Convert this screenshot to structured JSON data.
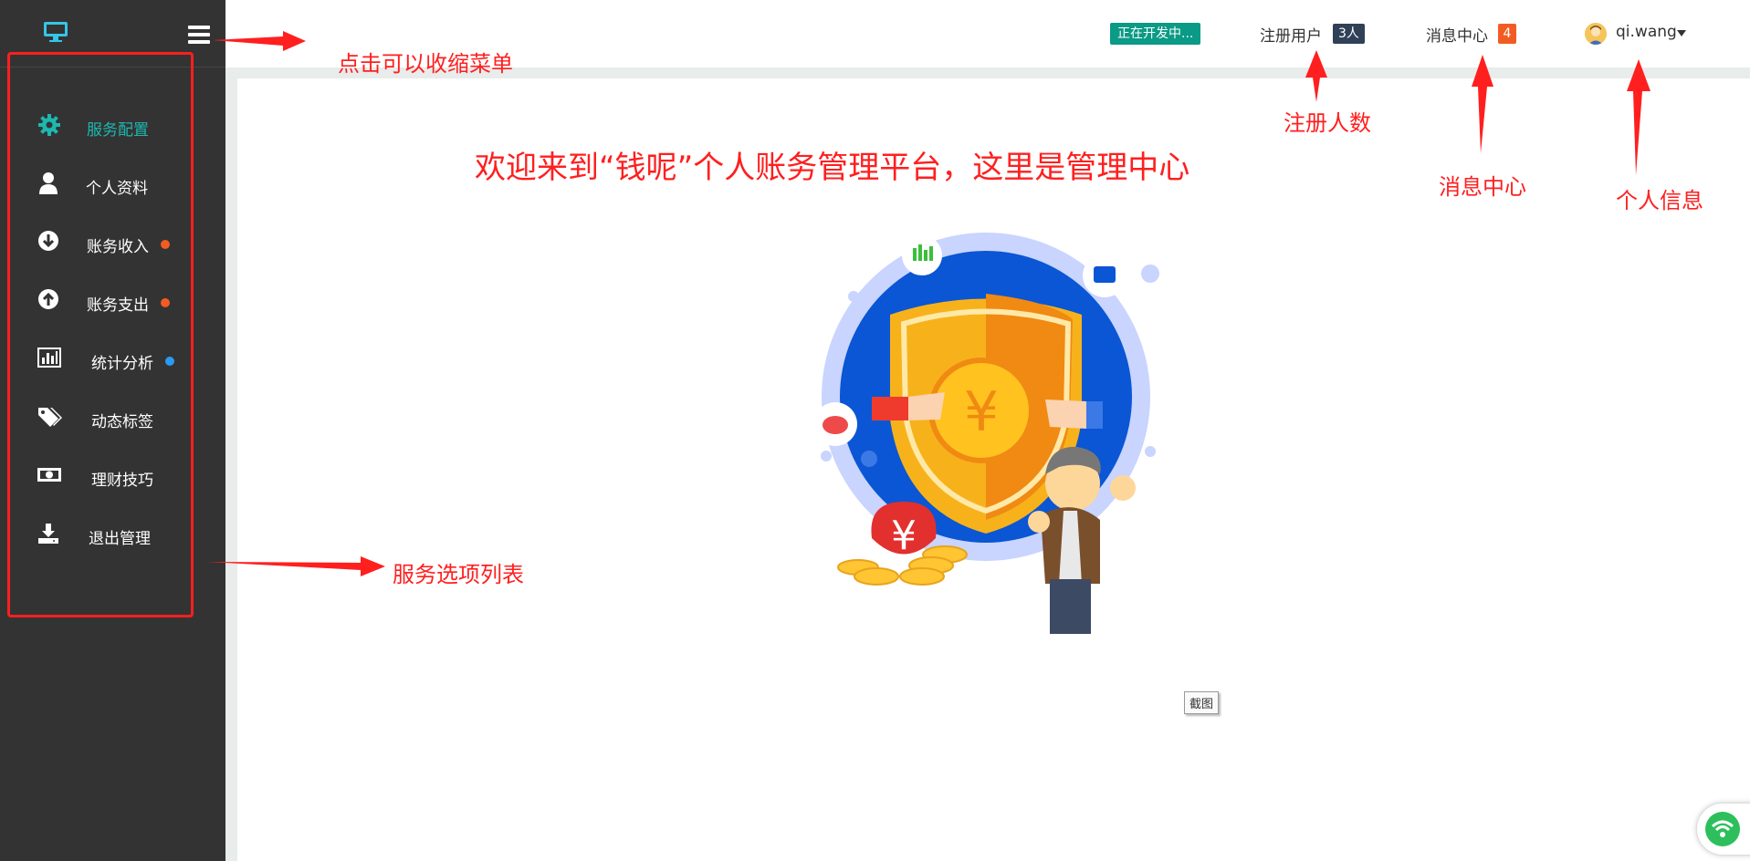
{
  "colors": {
    "sidebar_bg": "#333333",
    "active_teal": "#1cb8b0",
    "annotation_red": "#ff1f1f",
    "dev_badge": "#0b9a86",
    "reg_badge": "#2f4057",
    "msg_badge": "#f25c23",
    "dot_orange": "#f25c23",
    "dot_blue": "#2b9af3"
  },
  "sidebar": {
    "logo_icon": "monitor-icon",
    "toggle_icon": "hamburger-icon",
    "items": [
      {
        "label": "服务配置",
        "icon": "gear-icon",
        "active": true
      },
      {
        "label": "个人资料",
        "icon": "user-icon"
      },
      {
        "label": "账务收入",
        "icon": "arrow-circle-down-icon",
        "dot": "orange"
      },
      {
        "label": "账务支出",
        "icon": "arrow-circle-up-icon",
        "dot": "orange"
      },
      {
        "label": "统计分析",
        "icon": "bar-chart-icon",
        "dot": "blue"
      },
      {
        "label": "动态标签",
        "icon": "tags-icon"
      },
      {
        "label": "理财技巧",
        "icon": "money-icon"
      },
      {
        "label": "退出管理",
        "icon": "download-icon"
      }
    ]
  },
  "header": {
    "dev_status": "正在开发中...",
    "registered_label": "注册用户",
    "registered_count": "3人",
    "messages_label": "消息中心",
    "messages_count": "4",
    "user_name": "qi.wang"
  },
  "annotations": {
    "collapse_menu": "点击可以收缩菜单",
    "service_list": "服务选项列表",
    "registered_count": "注册人数",
    "message_center": "消息中心",
    "personal_info": "个人信息",
    "welcome": "欢迎来到“钱呢”个人账务管理平台，这里是管理中心"
  },
  "screenshot_tag": "截图"
}
